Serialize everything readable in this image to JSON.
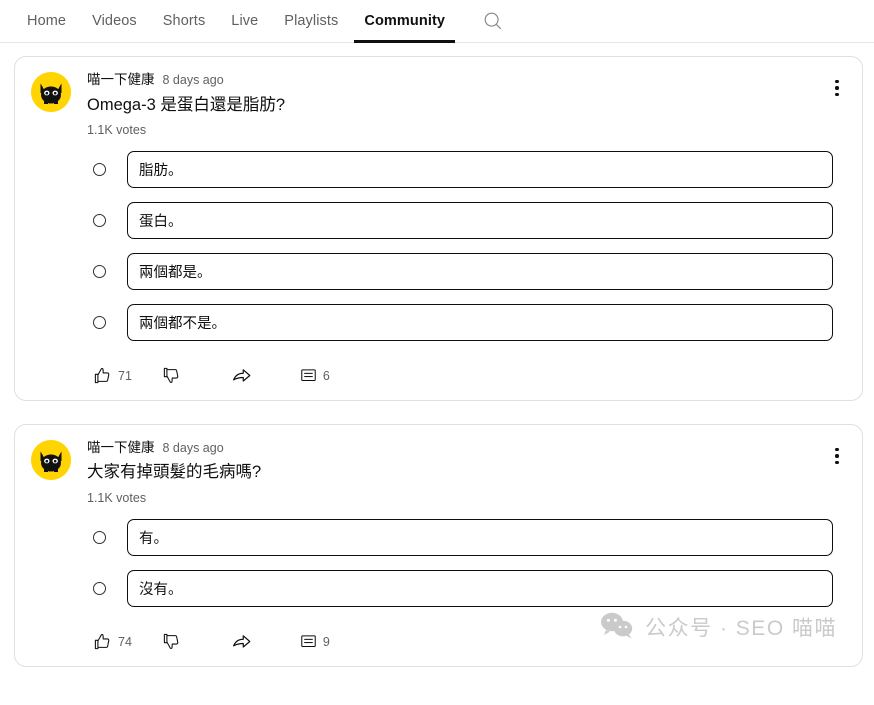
{
  "nav": {
    "tabs": [
      {
        "label": "Home",
        "active": false
      },
      {
        "label": "Videos",
        "active": false
      },
      {
        "label": "Shorts",
        "active": false
      },
      {
        "label": "Live",
        "active": false
      },
      {
        "label": "Playlists",
        "active": false
      },
      {
        "label": "Community",
        "active": true
      }
    ],
    "search_icon": "search-icon"
  },
  "theme": {
    "accent": "#FFD400",
    "text_primary": "#0f0f0f",
    "text_secondary": "#606060",
    "border": "#e0e0e0"
  },
  "posts": [
    {
      "channel": "喵一下健康",
      "timestamp": "8 days ago",
      "title": "Omega-3 是蛋白還是脂肪?",
      "votes": "1.1K votes",
      "menu_icon": "more-vertical-icon",
      "options": [
        {
          "label": "脂肪。"
        },
        {
          "label": "蛋白。"
        },
        {
          "label": "兩個都是。"
        },
        {
          "label": "兩個都不是。"
        }
      ],
      "actions": {
        "like_icon": "thumbs-up-icon",
        "like_count": "71",
        "dislike_icon": "thumbs-down-icon",
        "dislike_count": "",
        "share_icon": "share-icon",
        "comment_icon": "comment-icon",
        "comment_count": "6"
      }
    },
    {
      "channel": "喵一下健康",
      "timestamp": "8 days ago",
      "title": "大家有掉頭髮的毛病嗎?",
      "votes": "1.1K votes",
      "menu_icon": "more-vertical-icon",
      "options": [
        {
          "label": "有。"
        },
        {
          "label": "沒有。"
        }
      ],
      "actions": {
        "like_icon": "thumbs-up-icon",
        "like_count": "74",
        "dislike_icon": "thumbs-down-icon",
        "dislike_count": "",
        "share_icon": "share-icon",
        "comment_icon": "comment-icon",
        "comment_count": "9"
      }
    }
  ],
  "watermark": {
    "icon": "wechat-icon",
    "text": "公众号 · SEO 喵喵"
  }
}
